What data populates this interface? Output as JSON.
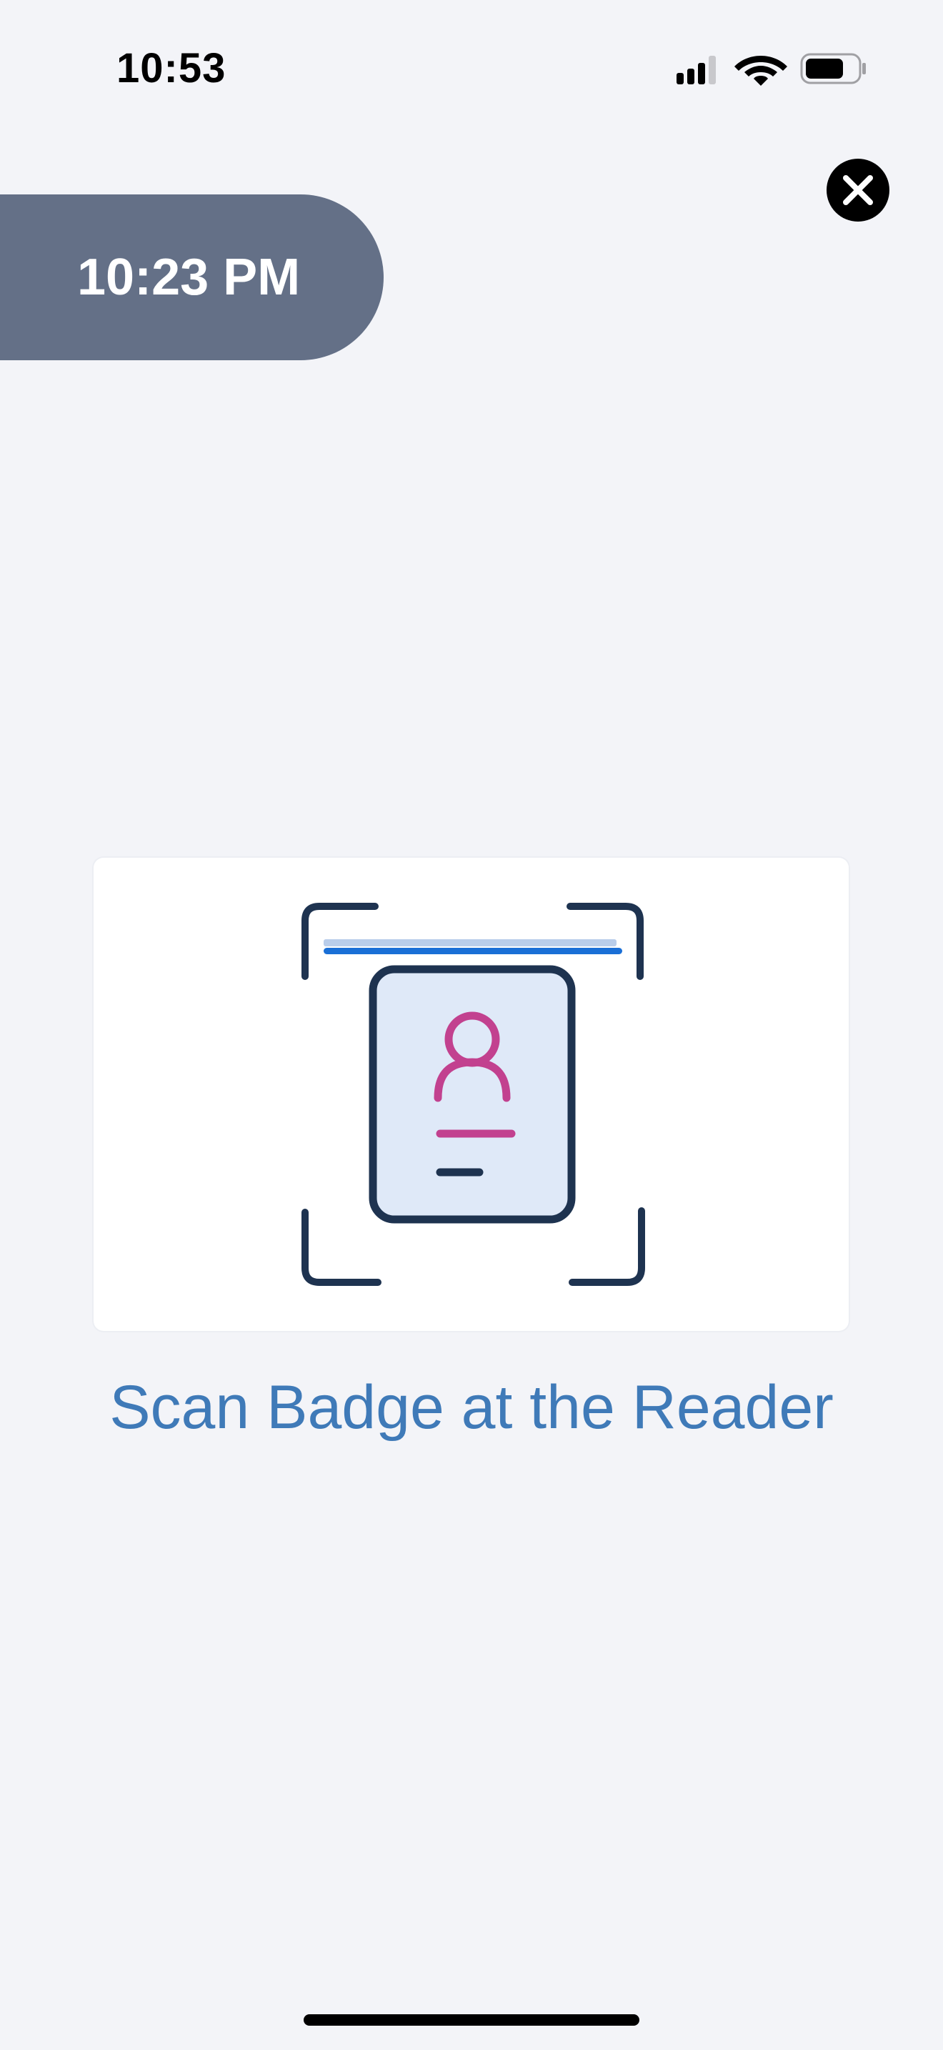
{
  "status_bar": {
    "time": "10:53",
    "icons": [
      "cellular-signal-icon",
      "wifi-icon",
      "battery-icon"
    ]
  },
  "close_button": {
    "icon": "close-icon"
  },
  "time_pill": {
    "label": "10:23 PM",
    "color": "#647087"
  },
  "badge_card": {
    "illustration": "badge-scan-icon",
    "colors": {
      "outline": "#1e3350",
      "scan_line": "#1a6fd6",
      "person": "#c2418f",
      "badge_fill": "#dfe9f8"
    }
  },
  "instruction": {
    "text": "Scan Badge at the Reader",
    "color": "#3f7ab8"
  }
}
